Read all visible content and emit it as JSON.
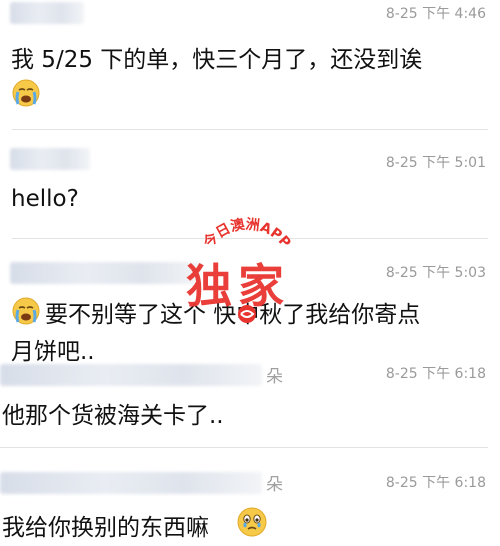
{
  "messages": [
    {
      "time": "8-25 下午 4:46",
      "text": "我 5/25 下的单，快三个月了，还没到诶",
      "emoji": "crying-face"
    },
    {
      "time": "8-25 下午 5:01",
      "text": "hello?"
    },
    {
      "time": "8-25 下午 5:03",
      "emoji": "crying-face",
      "text_line1": "要不别等了这个 快中秋了我给你寄点",
      "text_line2": "月饼吧.."
    },
    {
      "name_suffix": "朵",
      "time": "8-25 下午 6:18",
      "text": "他那个货被海关卡了.."
    },
    {
      "name_suffix": "朵",
      "time": "8-25 下午 6:18",
      "text": "我给你换别的东西嘛",
      "emoji": "teary-face"
    }
  ],
  "watermark": {
    "arc_text": "今日澳洲APP",
    "title": "独家"
  },
  "colors": {
    "watermark_red": "#e8342f",
    "emoji_yellow": "#f7c948",
    "tear_blue": "#5aa9e6"
  }
}
